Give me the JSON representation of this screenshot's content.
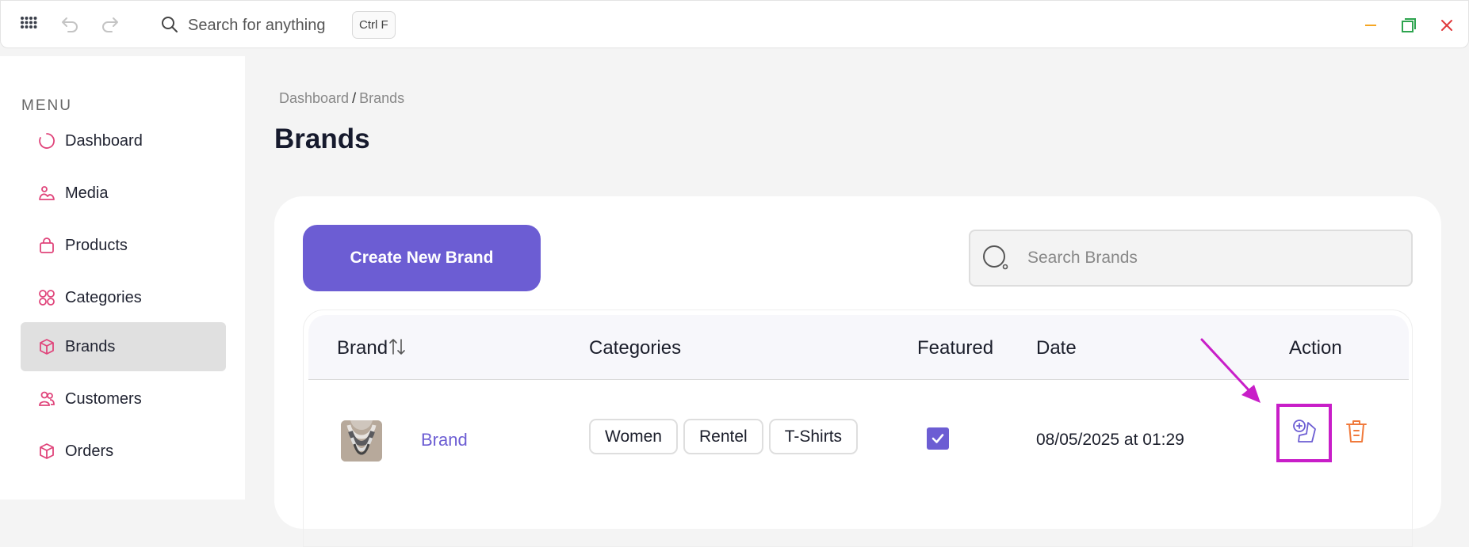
{
  "topbar": {
    "apps_icon": "apps-grid-icon",
    "undo_icon": "undo-icon",
    "redo_icon": "redo-icon",
    "search_placeholder": "Search for anything",
    "shortcut": "Ctrl F",
    "window": {
      "minimize_color": "#f5a623",
      "maximize_color": "#2ea44f",
      "close_color": "#e0393b"
    }
  },
  "sidebar": {
    "title": "MENU",
    "items": [
      {
        "label": "Dashboard",
        "icon": "dashboard-icon",
        "active": false
      },
      {
        "label": "Media",
        "icon": "media-icon",
        "active": false
      },
      {
        "label": "Products",
        "icon": "bag-icon",
        "active": false
      },
      {
        "label": "Categories",
        "icon": "categories-icon",
        "active": false
      },
      {
        "label": "Brands",
        "icon": "cube-icon",
        "active": true
      },
      {
        "label": "Customers",
        "icon": "users-icon",
        "active": false
      },
      {
        "label": "Orders",
        "icon": "box-icon",
        "active": false
      }
    ],
    "icon_color": "#e0457b"
  },
  "main": {
    "breadcrumb": {
      "parent": "Dashboard",
      "separator": "/",
      "current": "Brands"
    },
    "title": "Brands",
    "create_button": "Create New Brand",
    "search_placeholder": "Search Brands",
    "accent": "#6c5dd3",
    "table": {
      "headers": {
        "brand": "Brand",
        "categories": "Categories",
        "featured": "Featured",
        "date": "Date",
        "action": "Action"
      },
      "rows": [
        {
          "brand": "Brand",
          "categories": [
            "Women",
            "Rentel",
            "T-Shirts"
          ],
          "featured": true,
          "date": "08/05/2025 at 01:29"
        }
      ]
    }
  },
  "annotation": {
    "highlight_color": "#c81ec8"
  }
}
